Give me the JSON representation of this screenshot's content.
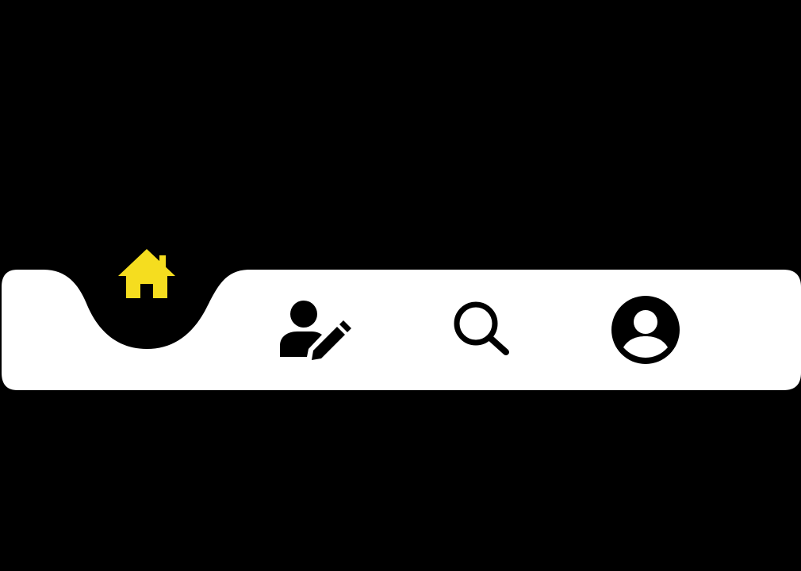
{
  "colors": {
    "background": "#000000",
    "bar": "#ffffff",
    "active": "#f5dd1f",
    "icon": "#000000"
  },
  "nav": {
    "active_item": "home",
    "items": [
      {
        "id": "home",
        "icon": "home-icon",
        "active": true
      },
      {
        "id": "edit-user",
        "icon": "user-edit-icon",
        "active": false
      },
      {
        "id": "search",
        "icon": "search-icon",
        "active": false
      },
      {
        "id": "profile",
        "icon": "account-circle-icon",
        "active": false
      }
    ]
  }
}
